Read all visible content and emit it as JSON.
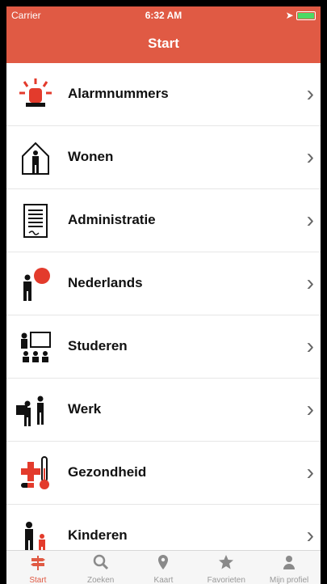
{
  "status": {
    "carrier": "Carrier",
    "time": "6:32 AM"
  },
  "header": {
    "title": "Start"
  },
  "list": [
    {
      "label": "Alarmnummers",
      "icon": "siren-icon"
    },
    {
      "label": "Wonen",
      "icon": "house-person-icon"
    },
    {
      "label": "Administratie",
      "icon": "document-icon"
    },
    {
      "label": "Nederlands",
      "icon": "speech-person-icon"
    },
    {
      "label": "Studeren",
      "icon": "classroom-icon"
    },
    {
      "label": "Werk",
      "icon": "work-icon"
    },
    {
      "label": "Gezondheid",
      "icon": "health-icon"
    },
    {
      "label": "Kinderen",
      "icon": "children-icon"
    }
  ],
  "tabs": [
    {
      "label": "Start",
      "icon": "signpost-icon",
      "active": true
    },
    {
      "label": "Zoeken",
      "icon": "search-icon"
    },
    {
      "label": "Kaart",
      "icon": "map-pin-icon"
    },
    {
      "label": "Favorieten",
      "icon": "star-icon"
    },
    {
      "label": "Mijn profiel",
      "icon": "person-icon"
    }
  ],
  "colors": {
    "accent": "#e05a44",
    "text": "#111111",
    "separator": "#e6e6e6"
  }
}
